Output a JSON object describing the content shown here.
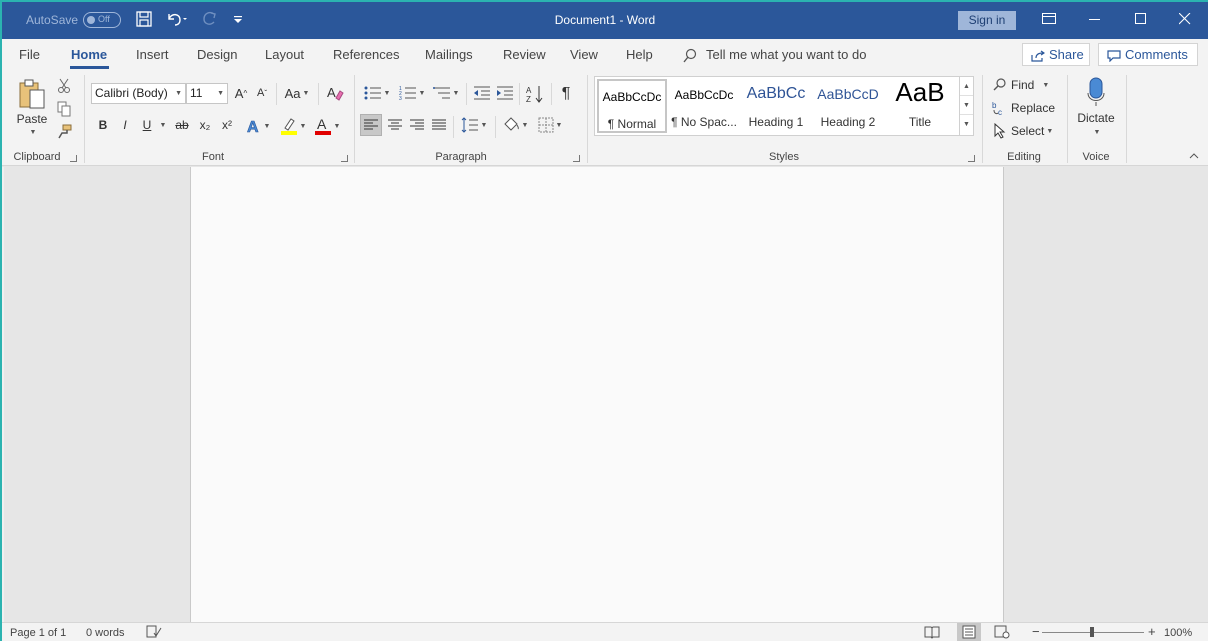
{
  "titlebar": {
    "autosave_label": "AutoSave",
    "autosave_state": "Off",
    "title": "Document1  -  Word",
    "signin": "Sign in"
  },
  "tabs": [
    "File",
    "Home",
    "Insert",
    "Design",
    "Layout",
    "References",
    "Mailings",
    "Review",
    "View",
    "Help"
  ],
  "tellme": "Tell me what you want to do",
  "share": "Share",
  "comments": "Comments",
  "clipboard": {
    "paste": "Paste",
    "group": "Clipboard"
  },
  "font": {
    "name": "Calibri (Body)",
    "size": "11",
    "group": "Font",
    "bold": "B",
    "italic": "I",
    "underline": "U",
    "strike": "ab",
    "subscript": "x₂",
    "superscript": "x²",
    "case": "Aa",
    "grow": "A",
    "shrink": "A",
    "highlight_color": "#ffff00",
    "font_color": "#e00000"
  },
  "paragraph": {
    "group": "Paragraph",
    "pilcrow": "¶"
  },
  "styles": {
    "group": "Styles",
    "items": [
      {
        "sample": "AaBbCcDc",
        "name": "¶ Normal"
      },
      {
        "sample": "AaBbCcDc",
        "name": "¶ No Spac..."
      },
      {
        "sample": "AaBbCc",
        "name": "Heading 1"
      },
      {
        "sample": "AaBbCcD",
        "name": "Heading 2"
      },
      {
        "sample": "AaB",
        "name": "Title"
      }
    ]
  },
  "editing": {
    "group": "Editing",
    "find": "Find",
    "replace": "Replace",
    "select": "Select"
  },
  "voice": {
    "group": "Voice",
    "dictate": "Dictate"
  },
  "status": {
    "page": "Page 1 of 1",
    "words": "0 words",
    "zoom": "100%",
    "zoom_minus": "−",
    "zoom_plus": "+"
  },
  "colors": {
    "brand": "#2b579a",
    "heading_blue": "#2f5496"
  }
}
